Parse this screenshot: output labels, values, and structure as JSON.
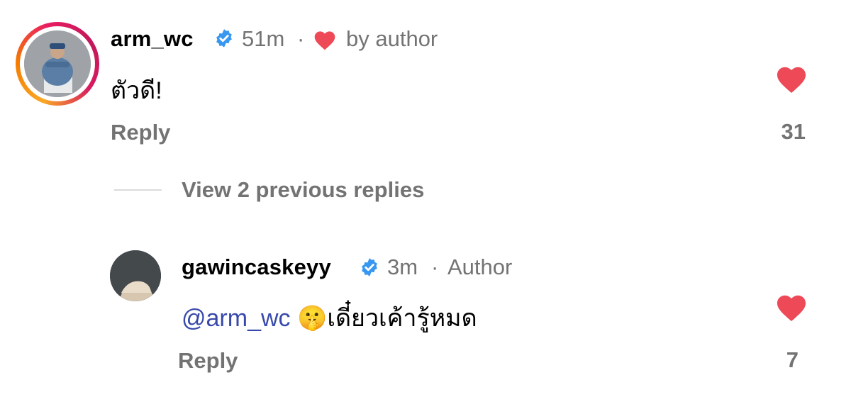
{
  "comments": [
    {
      "username": "arm_wc",
      "time": "51m",
      "separator": "·",
      "liked_by_label": "by author",
      "text": "ตัวดี!",
      "reply_label": "Reply",
      "like_count": "31"
    }
  ],
  "replies_toggle": {
    "label": "View 2 previous replies"
  },
  "replies": [
    {
      "username": "gawincaskeyy",
      "time": "3m",
      "separator": "·",
      "author_label": "Author",
      "mention": "@arm_wc",
      "emoji": "🤫",
      "text": "เดี๋ยวเค้ารู้หมด",
      "reply_label": "Reply",
      "like_count": "7"
    }
  ],
  "colors": {
    "heart": "#ed4956",
    "verified": "#3897f0",
    "mention": "#3949ab",
    "secondary_text": "#737373"
  },
  "icons": [
    "verified-badge-icon",
    "heart-icon",
    "like-heart-icon"
  ]
}
